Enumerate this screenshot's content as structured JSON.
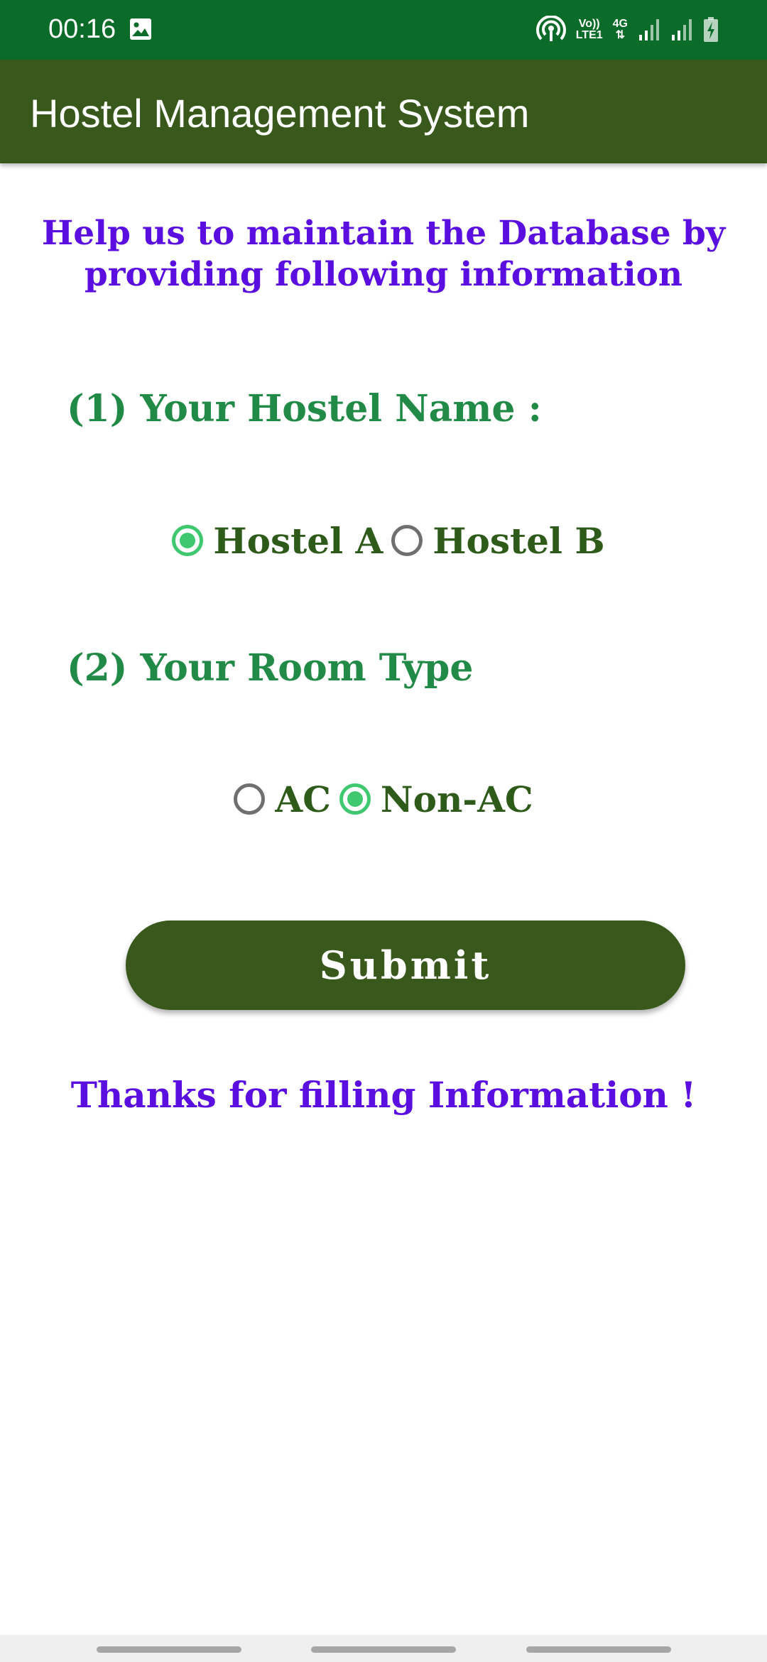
{
  "status_bar": {
    "time": "00:16",
    "volte_label": "Vo))",
    "lte_label": "LTE1",
    "network_label": "4G",
    "icons": [
      "image-icon",
      "hotspot-icon",
      "signal-icon",
      "signal-icon",
      "battery-charging-icon"
    ],
    "background_color": "#0b6b29"
  },
  "app_bar": {
    "title": "Hostel Management System",
    "background_color": "#38591b"
  },
  "form": {
    "intro": "Help us to maintain the Database by providing following information",
    "question_1": {
      "label": "(1) Your Hostel Name :",
      "options": [
        {
          "label": "Hostel A",
          "checked": true
        },
        {
          "label": "Hostel B",
          "checked": false
        }
      ]
    },
    "question_2": {
      "label": "(2) Your Room Type",
      "options": [
        {
          "label": "AC",
          "checked": false
        },
        {
          "label": "Non-AC",
          "checked": true
        }
      ]
    },
    "submit_label": "Submit",
    "thanks_message": "Thanks for filling Information !"
  },
  "colors": {
    "intro_text": "#5a0ee0",
    "question_text": "#208a46",
    "option_text": "#2e5a1a",
    "radio_checked": "#3fc870",
    "radio_unchecked": "#6f6f6f",
    "button": "#38591b"
  }
}
